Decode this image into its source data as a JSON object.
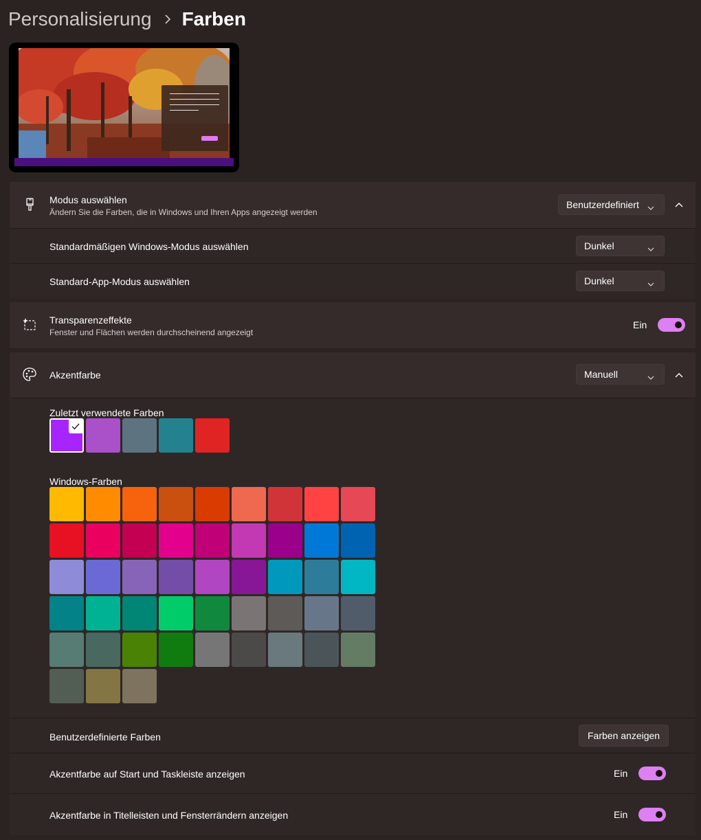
{
  "breadcrumb": {
    "parent": "Personalisierung",
    "current": "Farben"
  },
  "mode": {
    "title": "Modus auswählen",
    "description": "Ändern Sie die Farben, die in Windows und Ihren Apps angezeigt werden",
    "value": "Benutzerdefiniert",
    "windows_mode_label": "Standardmäßigen Windows-Modus auswählen",
    "windows_mode_value": "Dunkel",
    "app_mode_label": "Standard-App-Modus auswählen",
    "app_mode_value": "Dunkel"
  },
  "transparency": {
    "title": "Transparenzeffekte",
    "description": "Fenster und Flächen werden durchscheinend angezeigt",
    "state": "Ein"
  },
  "accent": {
    "title": "Akzentfarbe",
    "value": "Manuell",
    "recent_label": "Zuletzt verwendete Farben",
    "recent_colors": [
      "#a625ff",
      "#aa50c8",
      "#5d7380",
      "#24828f",
      "#e02424"
    ],
    "windows_label": "Windows-Farben",
    "windows_colors": [
      [
        "#ffb900",
        "#ff8c00",
        "#f7630c",
        "#ca5010",
        "#da3b01",
        "#ef6950",
        "#d13438",
        "#ff4343",
        "#e74856"
      ],
      [
        "#e81123",
        "#ea005e",
        "#c30052",
        "#e3008c",
        "#bf0077",
        "#c239b3",
        "#9a0089",
        "#0078d7",
        "#0063b1"
      ],
      [
        "#8e8cd8",
        "#6b69d6",
        "#8764b8",
        "#744da9",
        "#b146c2",
        "#881798",
        "#0099bc",
        "#2d7d9a",
        "#00b7c3"
      ],
      [
        "#038387",
        "#00b294",
        "#018574",
        "#00cc6a",
        "#10893e",
        "#7a7574",
        "#5d5a58",
        "#68768a",
        "#515c6b"
      ],
      [
        "#567c73",
        "#486860",
        "#498205",
        "#107c10",
        "#767676",
        "#4c4a48",
        "#69797e",
        "#4a5459",
        "#647c64"
      ],
      [
        "#525e54",
        "#847545",
        "#7e735f"
      ]
    ],
    "custom_label": "Benutzerdefinierte Farben",
    "custom_button": "Farben anzeigen",
    "start_taskbar_label": "Akzentfarbe auf Start und Taskleiste anzeigen",
    "start_taskbar_state": "Ein",
    "titlebar_label": "Akzentfarbe in Titelleisten und Fensterrändern anzeigen",
    "titlebar_state": "Ein"
  }
}
